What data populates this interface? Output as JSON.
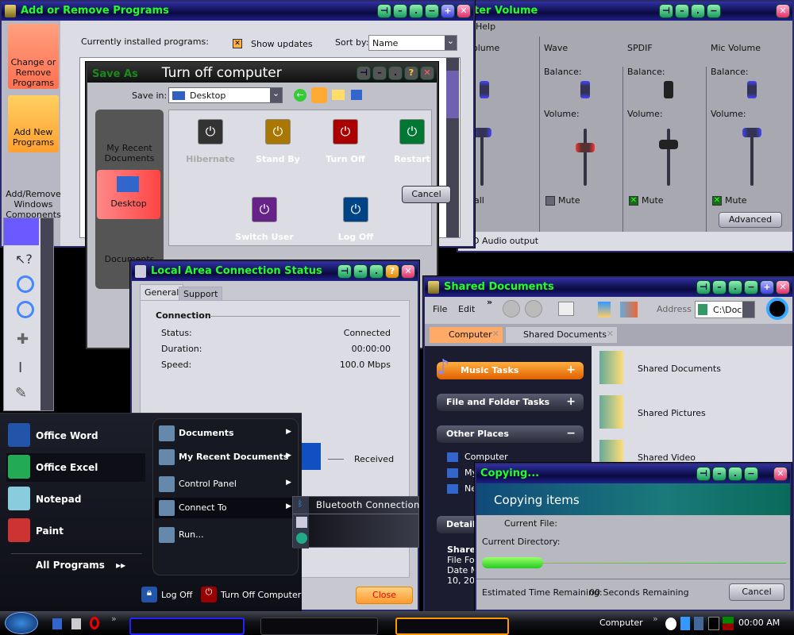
{
  "volume": {
    "title": "ter Volume",
    "menu": [
      "Help"
    ],
    "partial_label": "olume",
    "partial_mute": "all",
    "channels": [
      {
        "name": "Wave",
        "balance": "Balance:",
        "volume": "Volume:",
        "mute": "Mute",
        "muted": false,
        "level": 0.6
      },
      {
        "name": "SPDIF",
        "balance": "Balance:",
        "volume": "Volume:",
        "mute": "Mute",
        "muted": true,
        "level": 0.7
      },
      {
        "name": "Mic Volume",
        "balance": "Balance:",
        "volume": "Volume:",
        "mute": "Mute",
        "muted": true,
        "level": 0.9
      }
    ],
    "advanced": "Advanced",
    "status": "D Audio output"
  },
  "addremove": {
    "title": "Add or Remove Programs",
    "sidebar": [
      "Change or Remove Programs",
      "Add New Programs",
      "Add/Remove Windows Components"
    ],
    "installed": "Currently installed programs:",
    "show_updates": "Show updates",
    "sort_by": "Sort by:",
    "sort_value": "Name"
  },
  "turnoff": {
    "save_as": "Save As",
    "title": "Turn off computer",
    "save_in": "Save in:",
    "location": "Desktop",
    "places": [
      "My Recent Documents",
      "Desktop",
      "Documents"
    ],
    "actions": [
      "Hibernate",
      "Stand By",
      "Turn Off",
      "Restart",
      "Switch User",
      "Log Off"
    ],
    "cancel": "Cancel"
  },
  "lan": {
    "title": "Local Area Connection Status",
    "tabs": [
      "General",
      "Support"
    ],
    "group": "Connection",
    "rows": [
      {
        "k": "Status:",
        "v": "Connected"
      },
      {
        "k": "Duration:",
        "v": "00:00:00"
      },
      {
        "k": "Speed:",
        "v": "100.0 Mbps"
      }
    ],
    "received": "Received",
    "close": "Close"
  },
  "shared": {
    "title": "Shared Documents",
    "menu": [
      "File",
      "Edit"
    ],
    "address_label": "Address",
    "address": "C:\\Doc",
    "tabs": [
      "Computer",
      "Shared Documents"
    ],
    "panels": [
      "Music Tasks",
      "File and Folder Tasks",
      "Other Places",
      "Details"
    ],
    "places": [
      "Computer",
      "My",
      "Ne"
    ],
    "details": [
      "Share",
      "File Fol",
      "Date M",
      "10, 201"
    ],
    "files": [
      "Shared Documents",
      "Shared Pictures",
      "Shared Video"
    ]
  },
  "copying": {
    "title": "Copying...",
    "header": "Copying items",
    "current_file": "Current File:",
    "current_dir": "Current Directory:",
    "progress": 0.2,
    "eta_label": "Estimated Time Remaining:",
    "eta": "00 Seconds Remaining",
    "cancel": "Cancel"
  },
  "startmenu": {
    "left": [
      "Office Word",
      "Office Excel",
      "Notepad",
      "Paint"
    ],
    "all_programs": "All Programs",
    "right": [
      "Documents",
      "My Recent Documents",
      "Control Panel",
      "Connect To",
      "Run..."
    ],
    "submenu": [
      "Bluetooth Connection"
    ],
    "log_off": "Log Off",
    "turn_off": "Turn Off Computer"
  },
  "taskbar": {
    "computer": "Computer",
    "clock": "00:00 AM"
  }
}
